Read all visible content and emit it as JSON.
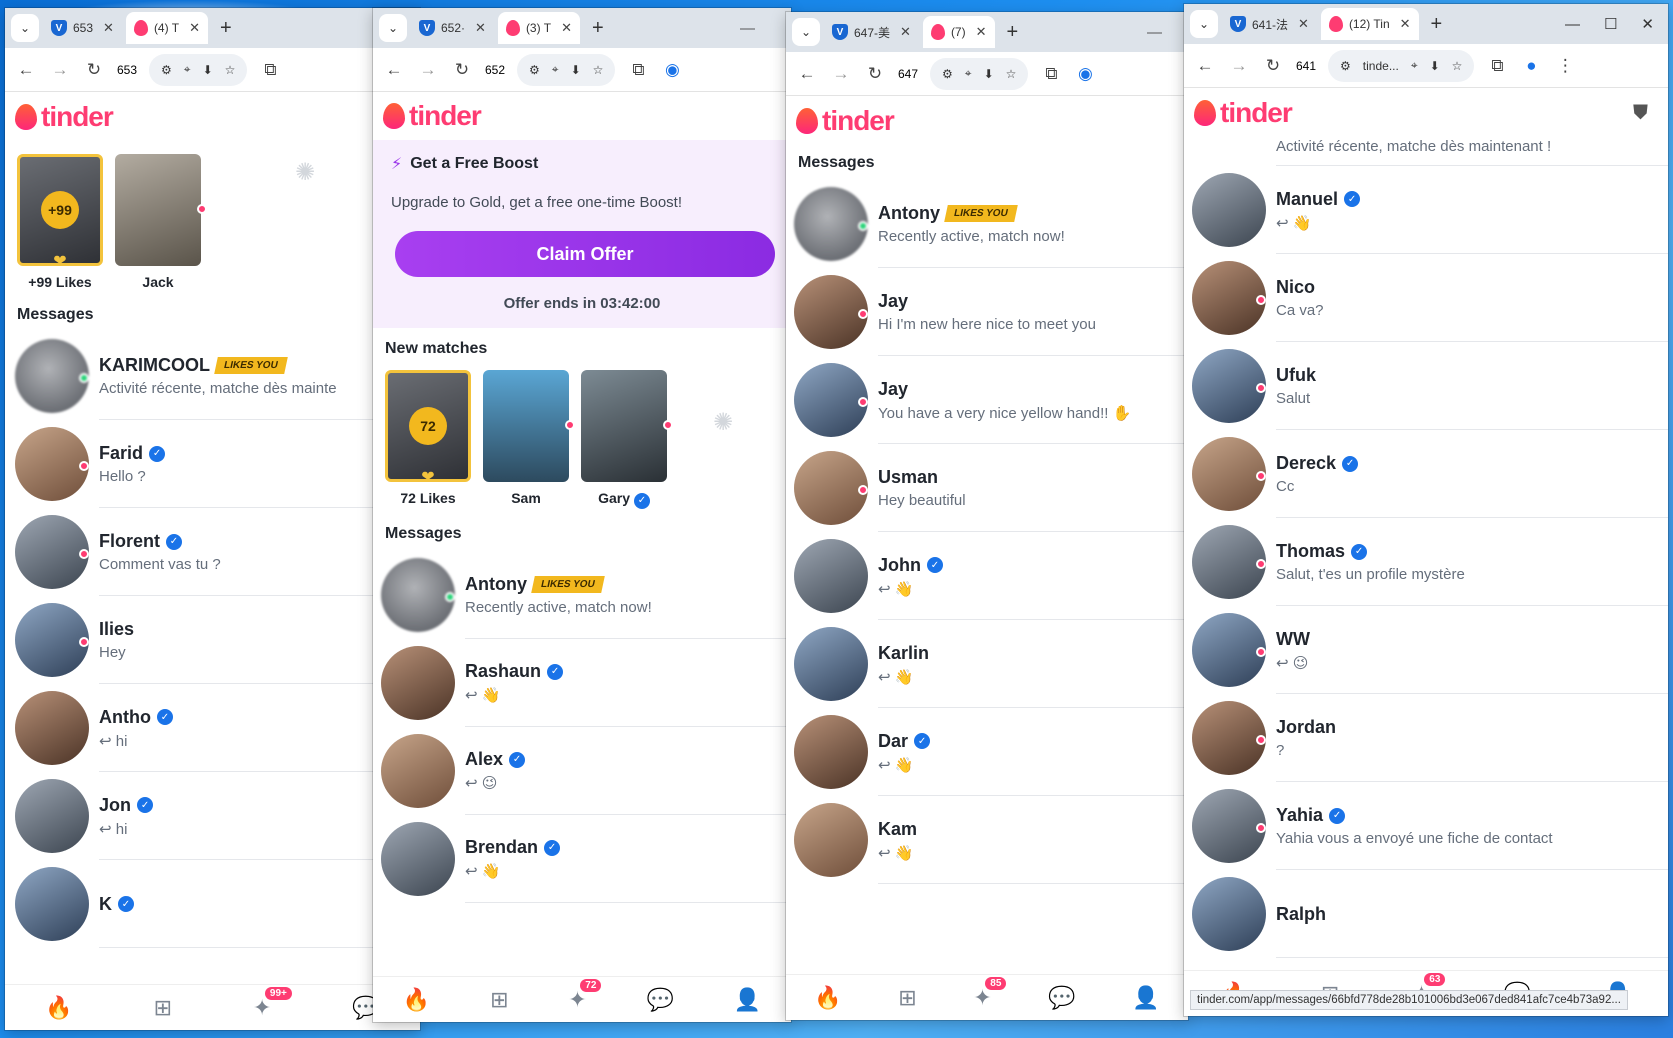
{
  "windows": [
    {
      "tabs": [
        {
          "label": "653",
          "icon": "shield"
        },
        {
          "label": "(4) T",
          "icon": "flame",
          "active": true
        }
      ],
      "address": "653",
      "stories": [
        {
          "label": "+99 Likes",
          "count": "+99",
          "type": "likes"
        },
        {
          "label": "Jack"
        }
      ],
      "messages_title": "Messages",
      "messages": [
        {
          "name": "KARIMCOOL",
          "badge": "LIKES YOU",
          "preview": "Activité récente, matche dès mainte",
          "online": "green"
        },
        {
          "name": "Farid",
          "verified": true,
          "preview": "Hello ?"
        },
        {
          "name": "Florent",
          "verified": true,
          "preview": "Comment vas tu ?"
        },
        {
          "name": "Ilies",
          "preview": "Hey"
        },
        {
          "name": "Antho",
          "verified": true,
          "preview": "↩ hi"
        },
        {
          "name": "Jon",
          "verified": true,
          "preview": "↩ hi"
        },
        {
          "name": "K",
          "verified": true,
          "preview": ""
        }
      ],
      "nav_badge": "99+"
    },
    {
      "tabs": [
        {
          "label": "652·",
          "icon": "shield"
        },
        {
          "label": "(3) T",
          "icon": "flame",
          "active": true
        }
      ],
      "address": "652",
      "boost": {
        "title": "Get a Free Boost",
        "subtitle": "Upgrade to Gold, get a free one-time Boost!",
        "button": "Claim Offer",
        "offer_ends": "Offer ends in 03:42:00"
      },
      "new_matches_title": "New matches",
      "stories": [
        {
          "label": "72 Likes",
          "count": "72",
          "type": "likes"
        },
        {
          "label": "Sam"
        },
        {
          "label": "Gary"
        }
      ],
      "messages_title": "Messages",
      "messages": [
        {
          "name": "Antony",
          "badge": "LIKES YOU",
          "preview": "Recently active, match now!",
          "online": "green"
        },
        {
          "name": "Rashaun",
          "verified": true,
          "preview": "↩ 👋"
        },
        {
          "name": "Alex",
          "verified": true,
          "preview": "↩ 😉"
        },
        {
          "name": "Brendan",
          "verified": true,
          "preview": "↩ 👋"
        }
      ],
      "nav_badge": "72"
    },
    {
      "tabs": [
        {
          "label": "647-美",
          "icon": "shield"
        },
        {
          "label": "(7)",
          "icon": "flame",
          "active": true
        }
      ],
      "address": "647",
      "messages_title": "Messages",
      "messages": [
        {
          "name": "Antony",
          "badge": "LIKES YOU",
          "preview": "Recently active, match now!",
          "online": "green"
        },
        {
          "name": "Jay",
          "preview": "Hi I'm new here nice to meet you"
        },
        {
          "name": "Jay",
          "preview": "You have a very nice yellow hand!! ✋"
        },
        {
          "name": "Usman",
          "preview": "Hey beautiful"
        },
        {
          "name": "John",
          "verified": true,
          "preview": "↩ 👋"
        },
        {
          "name": "Karlin",
          "preview": "↩ 👋"
        },
        {
          "name": "Dar",
          "verified": true,
          "preview": "↩ 👋"
        },
        {
          "name": "Kam",
          "preview": "↩ 👋"
        }
      ],
      "nav_badge": "85"
    },
    {
      "tabs": [
        {
          "label": "641-法",
          "icon": "shield"
        },
        {
          "label": "(12) Tin",
          "icon": "flame",
          "active": true
        }
      ],
      "address_num": "641",
      "address": "tinde...",
      "top_preview": "Activité récente, matche dès maintenant !",
      "messages": [
        {
          "name": "Manuel",
          "verified": true,
          "preview": "↩ 👋"
        },
        {
          "name": "Nico",
          "preview": "Ca va?"
        },
        {
          "name": "Ufuk",
          "preview": "Salut"
        },
        {
          "name": "Dereck",
          "verified": true,
          "preview": "Cc"
        },
        {
          "name": "Thomas",
          "verified": true,
          "preview": "Salut, t'es un profile mystère"
        },
        {
          "name": "WW",
          "preview": "↩ 😉"
        },
        {
          "name": "Jordan",
          "preview": "?"
        },
        {
          "name": "Yahia",
          "verified": true,
          "preview": "Yahia vous a envoyé une fiche de contact"
        },
        {
          "name": "Ralph",
          "preview": ""
        }
      ],
      "nav_badge": "63",
      "status_url": "tinder.com/app/messages/66bfd778de28b101006bd3e067ded841afc7ce4b73a92..."
    }
  ],
  "brand": {
    "logo_text": "tinder",
    "accent": "#fe3c72",
    "gold": "#f2b81e",
    "boost_purple": "#9a35ea"
  }
}
